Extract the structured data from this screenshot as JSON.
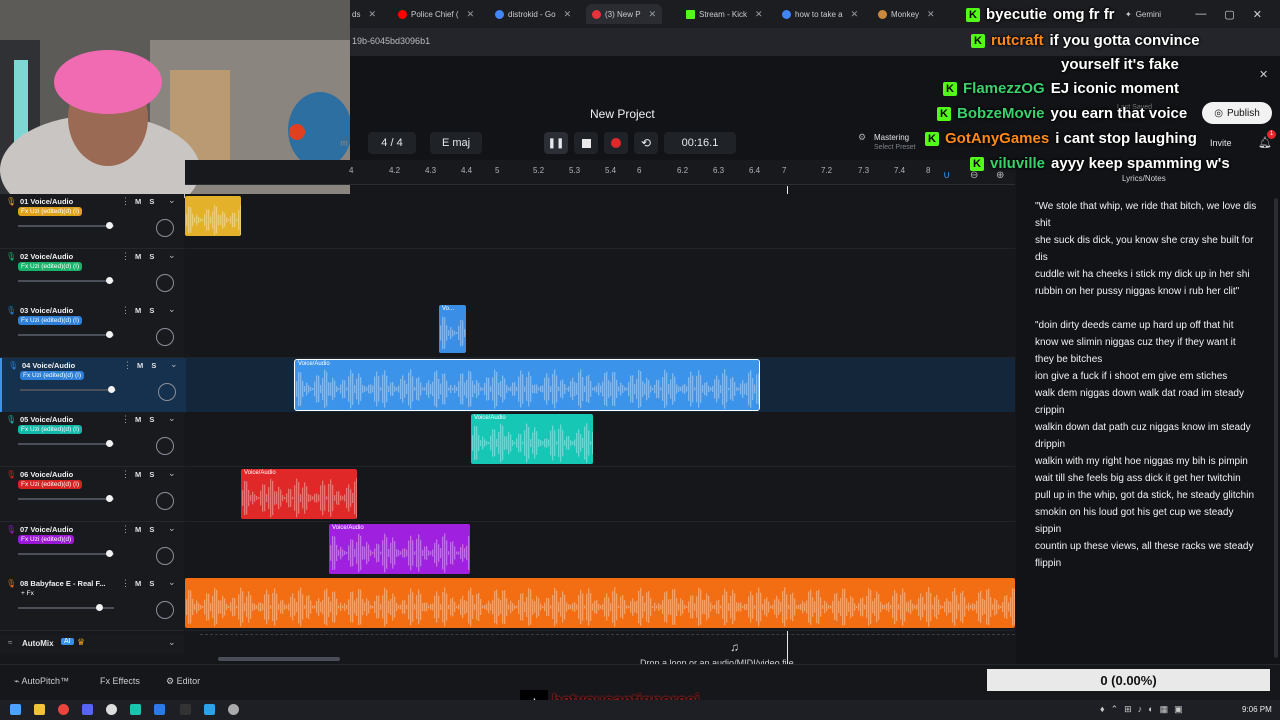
{
  "browser": {
    "tabs": [
      {
        "label": "ds",
        "color": "#7a7a7a"
      },
      {
        "label": "Police Chief (",
        "color": "#ff0000"
      },
      {
        "label": "distrokid - Go",
        "color": "#4285f4"
      },
      {
        "label": "(3) New P",
        "color": "#e8333a"
      },
      {
        "label": "Stream - Kick",
        "color": "#53fc18"
      },
      {
        "label": "how to take a",
        "color": "#4285f4"
      },
      {
        "label": "Monkey",
        "color": "#c98a3d"
      }
    ],
    "url": "19b-6045bd3096b1",
    "gemini_label": "Gemini"
  },
  "app": {
    "project_title": "New Project",
    "time_signature": "4 / 4",
    "key": "E maj",
    "time_display": "00:16.1",
    "mastering_label": "Mastering",
    "mastering_sub": "Select Preset",
    "publish_label": "Publish",
    "invite_label": "Invite",
    "last_saved": "Last Saved",
    "notif_count": "1"
  },
  "ruler": [
    "4",
    "4.2",
    "4.3",
    "4.4",
    "5",
    "5.2",
    "5.3",
    "5.4",
    "6",
    "6.2",
    "6.3",
    "6.4",
    "7",
    "7.2",
    "7.3",
    "7.4",
    "8"
  ],
  "tracks": [
    {
      "name": "01 Voice/Audio",
      "fx": "Fx Uzi (edited)(d) (I)",
      "fx_color": "#e0a21a",
      "mic_color": "#e0a21a",
      "clip_label": "",
      "clip_color": "#e3b22a",
      "vol": 0.98,
      "selected": false
    },
    {
      "name": "02 Voice/Audio",
      "fx": "Fx Uzi (edited)(d) (I)",
      "fx_color": "#18b26b",
      "mic_color": "#18b26b",
      "clip_label": "",
      "clip_color": "#18b26b",
      "vol": 0.98,
      "selected": false
    },
    {
      "name": "03 Voice/Audio",
      "fx": "Fx Uzi (edited)(d) (I)",
      "fx_color": "#2d7fd8",
      "mic_color": "#2d7fd8",
      "clip_label": "Vo...",
      "clip_color": "#3a8ee6",
      "vol": 0.98,
      "selected": false
    },
    {
      "name": "04 Voice/Audio",
      "fx": "Fx Uzi (edited)(d) (I)",
      "fx_color": "#2d7fd8",
      "mic_color": "#2d7fd8",
      "clip_label": "Voice/Audio",
      "clip_color": "#3c94ea",
      "vol": 0.98,
      "selected": true
    },
    {
      "name": "05 Voice/Audio",
      "fx": "Fx Uzi (edited)(d) (I)",
      "fx_color": "#12b8a8",
      "mic_color": "#12b8a8",
      "clip_label": "Voice/Audio",
      "clip_color": "#16c7b6",
      "vol": 0.98,
      "selected": false
    },
    {
      "name": "06 Voice/Audio",
      "fx": "Fx Uzi (edited)(d) (I)",
      "fx_color": "#d62222",
      "mic_color": "#d62222",
      "clip_label": "Voice/Audio",
      "clip_color": "#e02828",
      "vol": 0.98,
      "selected": false
    },
    {
      "name": "07 Voice/Audio",
      "fx": "Fx Uzi (edited)(d)",
      "fx_color": "#9b19d6",
      "mic_color": "#9b19d6",
      "clip_label": "Voice/Audio",
      "clip_color": "#a020e0",
      "vol": 0.98,
      "selected": false
    },
    {
      "name": "08 Babyface E - Real F...",
      "fx": "+ Fx",
      "fx_color": "transparent",
      "mic_color": "#f06a14",
      "clip_label": "",
      "clip_color": "#f36d12",
      "vol": 0.88,
      "selected": false
    }
  ],
  "automix": {
    "label": "AutoMix",
    "badge": "AI"
  },
  "drop_hint": "Drop a loop or an audio/MIDI/video file",
  "lyrics": {
    "title": "Lyrics/Notes",
    "text": "\"We stole that whip, we ride that bitch, we love dis shit\nshe suck dis dick, you know she cray she built for dis\ncuddle wit ha cheeks i stick my dick up in her shi\nrubbin on her pussy niggas know i rub her clit\"\n\n\"doin dirty deeds came up hard up off that hit\nknow we slimin niggas cuz they if they want it they be bitches\nion give a fuck if i shoot em give em stiches\nwalk dem niggas down walk dat road im steady crippin\nwalkin down dat path cuz niggas know im steady drippin\nwalkin with my right hoe niggas my bih is pimpin\nwait till she feels big ass dick it get her twitchin\npull up in the whip, got da stick, he steady glitchin\nsmokin on his loud got his get cup we steady sippin\ncountin up these views, all these racks we steady flippin"
  },
  "chat": [
    {
      "user": "byecutie",
      "msg": "omg fr fr",
      "color": "#ffffff"
    },
    {
      "user": "rutcraft",
      "msg": "if you gotta convince",
      "color": "#ff8a1a"
    },
    {
      "user": "",
      "msg": "yourself it's fake",
      "color": "#ffffff"
    },
    {
      "user": "FlamezzOG",
      "msg": "EJ iconic moment",
      "color": "#39d26b"
    },
    {
      "user": "BobzeMovie",
      "msg": "you earn that voice",
      "color": "#39d26b"
    },
    {
      "user": "GotAnyGames",
      "msg": "i cant stop laughing",
      "color": "#ff8a1a"
    },
    {
      "user": "viluville",
      "msg": "ayyy keep spamming w's",
      "color": "#39d26b"
    }
  ],
  "bottom": {
    "autopitch": "AutoPitch™",
    "effects": "Effects",
    "editor": "Editor",
    "donation": "0 (0.00%)",
    "tiktok": "hetyoucantignoreej"
  },
  "taskbar": {
    "time": "9:06 PM"
  },
  "colors": {
    "accent": "#3c94ea",
    "record": "#e0282a",
    "kick": "#53fc18"
  }
}
